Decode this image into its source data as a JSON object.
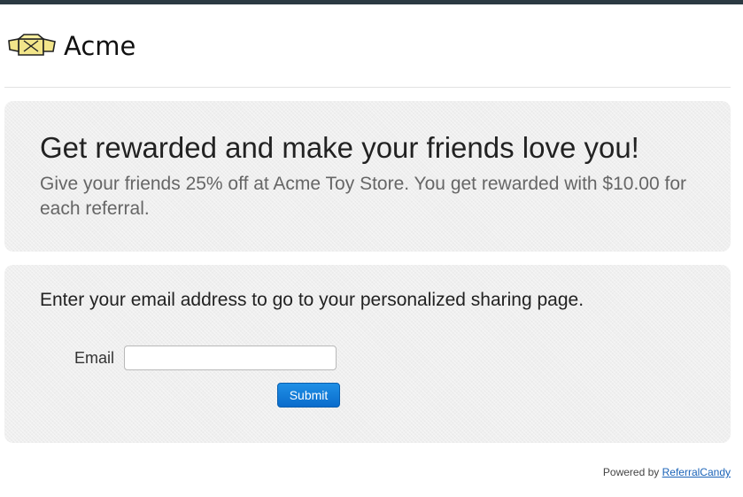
{
  "brand": {
    "name": "Acme",
    "logo_icon": "box-icon"
  },
  "hero": {
    "headline": "Get rewarded and make your friends love you!",
    "subline": "Give your friends 25% off at Acme Toy Store. You get rewarded with $10.00 for each referral."
  },
  "form": {
    "prompt": "Enter your email address to go to your personalized sharing page.",
    "email_label": "Email",
    "email_value": "",
    "submit_label": "Submit"
  },
  "footer": {
    "powered_by": "Powered by",
    "link_text": "ReferralCandy"
  },
  "colors": {
    "topbar": "#2b3a42",
    "button": "#0a6ccc",
    "link": "#1a63b8"
  }
}
